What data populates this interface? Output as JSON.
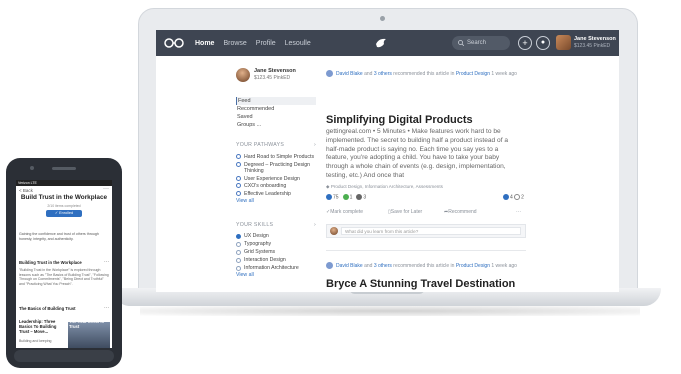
{
  "nav": {
    "links": [
      "Home",
      "Browse",
      "Profile",
      "Lesoulle"
    ],
    "search_placeholder": "Search",
    "user_name": "Jane Stevenson",
    "user_sub": "$123.45 PinkED"
  },
  "sidebar": {
    "name": "Jane Stevenson",
    "sub": "$123.45 PinkED",
    "menu": [
      "Feed",
      "Recommended",
      "Saved",
      "Groups ..."
    ],
    "pathways_header": "YOUR PATHWAYS",
    "pathways": [
      "Hard Road to Simple Products",
      "Degreed – Practicing Design Thinking",
      "User Experience Design",
      "CXO's onboarding",
      "Effective Leadership"
    ],
    "view_all": "View all",
    "skills_header": "YOUR SKILLS",
    "skills": [
      "UX Design",
      "Typography",
      "Grid Systems",
      "Interaction Design",
      "Information Architecture"
    ],
    "view_all_2": "View all"
  },
  "feed": {
    "item1": {
      "rec_by": "David Blake",
      "rec_and": "and",
      "rec_others": "3 others",
      "rec_mid": "recommended this article in",
      "rec_group": "Product Design",
      "rec_time": "1 week ago",
      "title": "Simplifying Digital Products",
      "body": "gettingreal.com • 5 Minutes • Make features work hard to be implemented. The secret to building half a product instead of a half-made product is saying no. Each time you say yes to a feature, you're adopting a child. You have to take your baby through a whole chain of events (e.g. design, implementation, testing, etc.) And once that",
      "tags": "Product Design, Information Architecture, Assessments",
      "stats": [
        "75",
        "1",
        "3"
      ],
      "stats_right": [
        "4",
        "2"
      ],
      "actions": [
        "Mark complete",
        "Save for Later",
        "Recommend"
      ],
      "more": "···",
      "comment_placeholder": "What did you learn from this article?"
    },
    "item2": {
      "rec_by": "David Blake",
      "rec_and": "and",
      "rec_others": "3 others",
      "rec_mid": "recommended this article in",
      "rec_group": "Product Design",
      "rec_time": "1 week ago",
      "title": "Bryce A Stunning Travel Destination"
    }
  },
  "phone": {
    "status": "Verizon LTE",
    "back": "< Back",
    "more": "···",
    "title": "Build Trust in the Workplace",
    "sub": "2/10 items completed",
    "enroll": "✓ Enrolled",
    "desc": "Gaining the confidence and trust of others through honesty, integrity, and authenticity.",
    "sec1": "Building Trust in the Workplace",
    "sec1_text": "\"Building Trust in the Workplace\" is explored through lessons such as \"The Basics of Building Trust\", \"Following Through on Commitments\", \"Being Direct and Truthful\" and \"Practicing What You Preach\".",
    "sec2": "The Basics of Building Trust",
    "card1": "Leadership: Three Basics To Building Trust – Move...",
    "card2": "The Real Crisis is Trust",
    "card_sub": "Building and keeping"
  },
  "colors": {
    "nav_bg": "#3e4552",
    "accent": "#2f6fc0"
  }
}
